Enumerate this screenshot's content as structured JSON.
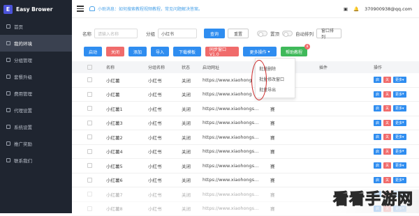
{
  "brand": {
    "logo_letter": "E",
    "name": "Easy Brower"
  },
  "sidebar": {
    "items": [
      {
        "label": "首页",
        "active": false
      },
      {
        "label": "我的环境",
        "active": true
      },
      {
        "label": "分组管理",
        "active": false
      },
      {
        "label": "套餐升级",
        "active": false
      },
      {
        "label": "费用管理",
        "active": false
      },
      {
        "label": "代理设置",
        "active": false
      },
      {
        "label": "系统设置",
        "active": false
      },
      {
        "label": "推广奖励",
        "active": false
      },
      {
        "label": "联系我们",
        "active": false
      }
    ]
  },
  "topbar": {
    "notice": "小助消息：如何搜索教程视频教程，常见问题解决答案。",
    "user": "370900938@qq.com"
  },
  "filters": {
    "name_label": "名称",
    "name_placeholder": "请输入名称",
    "group_label": "分组",
    "group_value": "小红书",
    "search": "查询",
    "reset": "重置",
    "hide_label": "置顶",
    "auto_label": "自动排列",
    "window_sort": "窗口排列"
  },
  "actions": {
    "start": "启动",
    "close": "关闭",
    "add": "添加",
    "import": "导入",
    "download_template": "下载模板",
    "sync": "同步窗口V1.0",
    "more": "更多操作",
    "help": "帮助教程",
    "help_badge": "8"
  },
  "table": {
    "headers": {
      "name": "名称",
      "group": "分组名称",
      "status": "状态",
      "url": "启动网址",
      "plugin": "插件",
      "ops": "操作"
    },
    "rows": [
      {
        "name": "小红薯",
        "group": "小红书",
        "status": "关闭",
        "url": "https://www.xiaohong",
        "extra": ""
      },
      {
        "name": "小红薯",
        "group": "小红书",
        "status": "关闭",
        "url": "https://www.xiaohong",
        "extra": ""
      },
      {
        "name": "小红薯1",
        "group": "小红书",
        "status": "关闭",
        "url": "https://www.xiaohongs...",
        "extra": "赛"
      },
      {
        "name": "小红薯3",
        "group": "小红书",
        "status": "关闭",
        "url": "https://www.xiaohongs...",
        "extra": "赛"
      },
      {
        "name": "小红薯2",
        "group": "小红书",
        "status": "关闭",
        "url": "https://www.xiaohongs...",
        "extra": "赛"
      },
      {
        "name": "小红薯4",
        "group": "小红书",
        "status": "关闭",
        "url": "https://www.xiaohongs...",
        "extra": "赛"
      },
      {
        "name": "小红薯5",
        "group": "小红书",
        "status": "关闭",
        "url": "https://www.xiaohongs...",
        "extra": "赛"
      },
      {
        "name": "小红薯6",
        "group": "小红书",
        "status": "关闭",
        "url": "https://www.xiaohongs...",
        "extra": "赛"
      },
      {
        "name": "小红薯7",
        "group": "小红书",
        "status": "关闭",
        "url": "https://www.xiaohongs...",
        "extra": "赛"
      },
      {
        "name": "小红薯8",
        "group": "小红书",
        "status": "关闭",
        "url": "https://www.xiaohongs...",
        "extra": "赛"
      }
    ],
    "op_start": "启",
    "op_close": "关",
    "op_more": "更多"
  },
  "dropdown": {
    "items": [
      "批量删除",
      "批量修改窗口",
      "批量导出"
    ]
  },
  "watermark": "看看手游网"
}
